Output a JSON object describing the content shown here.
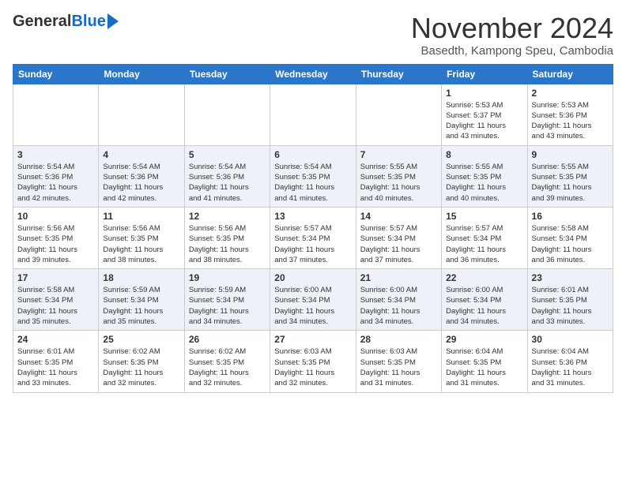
{
  "header": {
    "logo_general": "General",
    "logo_blue": "Blue",
    "month_title": "November 2024",
    "subtitle": "Basedth, Kampong Speu, Cambodia"
  },
  "days_of_week": [
    "Sunday",
    "Monday",
    "Tuesday",
    "Wednesday",
    "Thursday",
    "Friday",
    "Saturday"
  ],
  "weeks": [
    [
      {
        "day": "",
        "info": ""
      },
      {
        "day": "",
        "info": ""
      },
      {
        "day": "",
        "info": ""
      },
      {
        "day": "",
        "info": ""
      },
      {
        "day": "",
        "info": ""
      },
      {
        "day": "1",
        "info": "Sunrise: 5:53 AM\nSunset: 5:37 PM\nDaylight: 11 hours\nand 43 minutes."
      },
      {
        "day": "2",
        "info": "Sunrise: 5:53 AM\nSunset: 5:36 PM\nDaylight: 11 hours\nand 43 minutes."
      }
    ],
    [
      {
        "day": "3",
        "info": "Sunrise: 5:54 AM\nSunset: 5:36 PM\nDaylight: 11 hours\nand 42 minutes."
      },
      {
        "day": "4",
        "info": "Sunrise: 5:54 AM\nSunset: 5:36 PM\nDaylight: 11 hours\nand 42 minutes."
      },
      {
        "day": "5",
        "info": "Sunrise: 5:54 AM\nSunset: 5:36 PM\nDaylight: 11 hours\nand 41 minutes."
      },
      {
        "day": "6",
        "info": "Sunrise: 5:54 AM\nSunset: 5:35 PM\nDaylight: 11 hours\nand 41 minutes."
      },
      {
        "day": "7",
        "info": "Sunrise: 5:55 AM\nSunset: 5:35 PM\nDaylight: 11 hours\nand 40 minutes."
      },
      {
        "day": "8",
        "info": "Sunrise: 5:55 AM\nSunset: 5:35 PM\nDaylight: 11 hours\nand 40 minutes."
      },
      {
        "day": "9",
        "info": "Sunrise: 5:55 AM\nSunset: 5:35 PM\nDaylight: 11 hours\nand 39 minutes."
      }
    ],
    [
      {
        "day": "10",
        "info": "Sunrise: 5:56 AM\nSunset: 5:35 PM\nDaylight: 11 hours\nand 39 minutes."
      },
      {
        "day": "11",
        "info": "Sunrise: 5:56 AM\nSunset: 5:35 PM\nDaylight: 11 hours\nand 38 minutes."
      },
      {
        "day": "12",
        "info": "Sunrise: 5:56 AM\nSunset: 5:35 PM\nDaylight: 11 hours\nand 38 minutes."
      },
      {
        "day": "13",
        "info": "Sunrise: 5:57 AM\nSunset: 5:34 PM\nDaylight: 11 hours\nand 37 minutes."
      },
      {
        "day": "14",
        "info": "Sunrise: 5:57 AM\nSunset: 5:34 PM\nDaylight: 11 hours\nand 37 minutes."
      },
      {
        "day": "15",
        "info": "Sunrise: 5:57 AM\nSunset: 5:34 PM\nDaylight: 11 hours\nand 36 minutes."
      },
      {
        "day": "16",
        "info": "Sunrise: 5:58 AM\nSunset: 5:34 PM\nDaylight: 11 hours\nand 36 minutes."
      }
    ],
    [
      {
        "day": "17",
        "info": "Sunrise: 5:58 AM\nSunset: 5:34 PM\nDaylight: 11 hours\nand 35 minutes."
      },
      {
        "day": "18",
        "info": "Sunrise: 5:59 AM\nSunset: 5:34 PM\nDaylight: 11 hours\nand 35 minutes."
      },
      {
        "day": "19",
        "info": "Sunrise: 5:59 AM\nSunset: 5:34 PM\nDaylight: 11 hours\nand 34 minutes."
      },
      {
        "day": "20",
        "info": "Sunrise: 6:00 AM\nSunset: 5:34 PM\nDaylight: 11 hours\nand 34 minutes."
      },
      {
        "day": "21",
        "info": "Sunrise: 6:00 AM\nSunset: 5:34 PM\nDaylight: 11 hours\nand 34 minutes."
      },
      {
        "day": "22",
        "info": "Sunrise: 6:00 AM\nSunset: 5:34 PM\nDaylight: 11 hours\nand 34 minutes."
      },
      {
        "day": "23",
        "info": "Sunrise: 6:01 AM\nSunset: 5:35 PM\nDaylight: 11 hours\nand 33 minutes."
      }
    ],
    [
      {
        "day": "24",
        "info": "Sunrise: 6:01 AM\nSunset: 5:35 PM\nDaylight: 11 hours\nand 33 minutes."
      },
      {
        "day": "25",
        "info": "Sunrise: 6:02 AM\nSunset: 5:35 PM\nDaylight: 11 hours\nand 32 minutes."
      },
      {
        "day": "26",
        "info": "Sunrise: 6:02 AM\nSunset: 5:35 PM\nDaylight: 11 hours\nand 32 minutes."
      },
      {
        "day": "27",
        "info": "Sunrise: 6:03 AM\nSunset: 5:35 PM\nDaylight: 11 hours\nand 32 minutes."
      },
      {
        "day": "28",
        "info": "Sunrise: 6:03 AM\nSunset: 5:35 PM\nDaylight: 11 hours\nand 31 minutes."
      },
      {
        "day": "29",
        "info": "Sunrise: 6:04 AM\nSunset: 5:35 PM\nDaylight: 11 hours\nand 31 minutes."
      },
      {
        "day": "30",
        "info": "Sunrise: 6:04 AM\nSunset: 5:36 PM\nDaylight: 11 hours\nand 31 minutes."
      }
    ]
  ]
}
